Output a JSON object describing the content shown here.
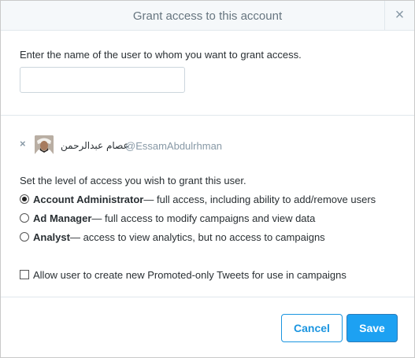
{
  "dialog": {
    "title": "Grant access to this account",
    "close_glyph": "×"
  },
  "grant": {
    "prompt": "Enter the name of the user to whom you want to grant access.",
    "input_value": "",
    "input_placeholder": ""
  },
  "selected_user": {
    "remove_glyph": "×",
    "display_name": "عصام عبدالرحمن",
    "handle": "@EssamAbdulrhman"
  },
  "access": {
    "instruction": "Set the level of access you wish to grant this user.",
    "options": [
      {
        "title": "Account Administrator",
        "description": " — full access, including ability to add/remove users",
        "checked": true
      },
      {
        "title": "Ad Manager",
        "description": " — full access to modify campaigns and view data",
        "checked": false
      },
      {
        "title": "Analyst",
        "description": " — access to view analytics, but no access to campaigns",
        "checked": false
      }
    ],
    "promoted_tweets_label": "Allow user to create new Promoted-only Tweets for use in campaigns",
    "promoted_tweets_checked": false
  },
  "footer": {
    "cancel_label": "Cancel",
    "save_label": "Save"
  },
  "colors": {
    "accent": "#1da1f2",
    "accent_border": "#1b95e0",
    "header_bg": "#f5f8fa",
    "muted_text": "#8899a6"
  }
}
